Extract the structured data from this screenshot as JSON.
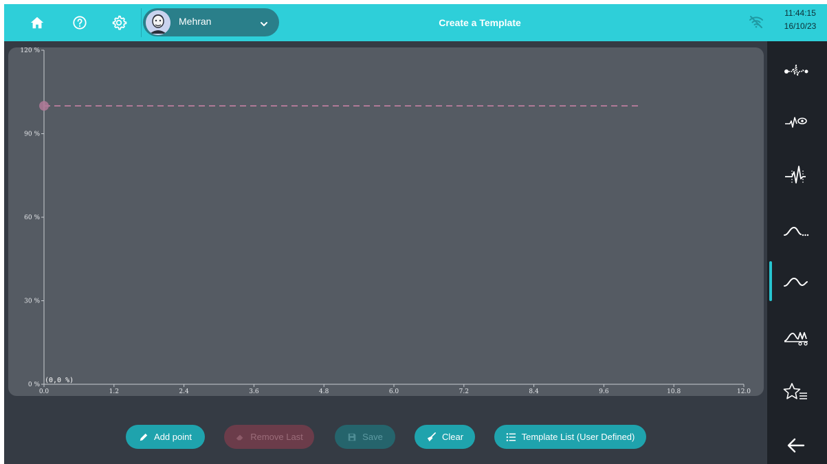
{
  "topbar": {
    "title": "Create a Template",
    "user_name": "Mehran",
    "time": "11:44:15",
    "date": "16/10/23",
    "icons": [
      "home-icon",
      "help-icon",
      "gear-icon",
      "avatar",
      "chevron-down-icon",
      "wifi-off-icon"
    ]
  },
  "sidebar": {
    "items": [
      {
        "name": "ecg-marker-icon"
      },
      {
        "name": "ecg-eye-icon"
      },
      {
        "name": "ecg-spike-icon"
      },
      {
        "name": "curve-dots-icon"
      },
      {
        "name": "curve-wave-icon",
        "active": true
      },
      {
        "name": "curve-points-icon"
      },
      {
        "name": "star-list-icon"
      },
      {
        "name": "back-arrow-icon"
      }
    ]
  },
  "buttons": {
    "add_point": "Add point",
    "remove_last": "Remove Last",
    "save": "Save",
    "clear": "Clear",
    "template_list": "Template List (User Defined)"
  },
  "colors": {
    "accent": "#2ecfd9",
    "button_teal": "#1fa3ad",
    "button_remove_disabled": "#6b3c4a",
    "button_save_disabled": "#25646c",
    "panel": "#555b63",
    "background": "#353b44",
    "sidebar": "#1e2228",
    "series": "#b07a98"
  },
  "chart_data": {
    "type": "line",
    "xlim": [
      0,
      12.0
    ],
    "ylim": [
      0,
      120
    ],
    "x_ticks": [
      "0.0",
      "1.2",
      "2.4",
      "3.6",
      "4.8",
      "6.0",
      "7.2",
      "8.4",
      "9.6",
      "10.8",
      "12.0"
    ],
    "y_ticks": [
      "0 %",
      "30 %",
      "60 %",
      "90 %",
      "120 %"
    ],
    "y_tick_values": [
      0,
      30,
      60,
      90,
      120
    ],
    "x_tick_values": [
      0,
      1.2,
      2.4,
      3.6,
      4.8,
      6.0,
      7.2,
      8.4,
      9.6,
      10.8,
      12.0
    ],
    "origin_label": "(0,0 %)",
    "points": [
      {
        "x": 0,
        "y": 100
      }
    ],
    "reference_line": {
      "y": 100,
      "x_end": 10.2,
      "style": "dashed"
    },
    "grid": false
  }
}
